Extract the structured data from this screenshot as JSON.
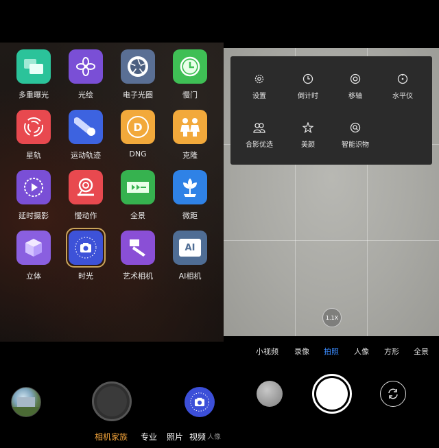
{
  "left": {
    "modes": [
      {
        "label": "多重曝光",
        "icon": "multi-exposure-icon",
        "color": "#2bc39a"
      },
      {
        "label": "光绘",
        "icon": "light-painting-icon",
        "color": "#7a4fd6"
      },
      {
        "label": "电子光圈",
        "icon": "aperture-icon",
        "color": "#5a6f94"
      },
      {
        "label": "慢门",
        "icon": "slow-shutter-icon",
        "color": "#3fbf55"
      },
      {
        "label": "星轨",
        "icon": "star-trail-icon",
        "color": "#e8494f"
      },
      {
        "label": "运动轨迹",
        "icon": "motion-trail-icon",
        "color": "#3d63e0"
      },
      {
        "label": "DNG",
        "icon": "dng-icon",
        "color": "#f2a93b"
      },
      {
        "label": "克隆",
        "icon": "clone-icon",
        "color": "#f2a93b"
      },
      {
        "label": "延时摄影",
        "icon": "timelapse-icon",
        "color": "#7a4fd6"
      },
      {
        "label": "慢动作",
        "icon": "slow-motion-icon",
        "color": "#e8494f"
      },
      {
        "label": "全景",
        "icon": "panorama-icon",
        "color": "#36b24f"
      },
      {
        "label": "微距",
        "icon": "macro-icon",
        "color": "#2f82e6"
      },
      {
        "label": "立体",
        "icon": "cube-icon",
        "color": "#8a5fe0"
      },
      {
        "label": "时光",
        "icon": "time-camera-icon",
        "color": "#3d52d8"
      },
      {
        "label": "艺术相机",
        "icon": "art-brush-icon",
        "color": "#8a4fd6"
      },
      {
        "label": "AI相机",
        "icon": "ai-camera-icon",
        "color": "#4f6d94"
      }
    ],
    "dng_letter": "D",
    "ai_text": "AI",
    "tabs": [
      {
        "label": "相机家族",
        "state": "active"
      },
      {
        "label": "专业",
        "state": "normal"
      },
      {
        "label": "照片",
        "state": "normal"
      },
      {
        "label": "视频",
        "state": "normal"
      },
      {
        "label": "人像",
        "state": "faded"
      }
    ],
    "accent_color": "#f0a23a",
    "selected_mode": "时光"
  },
  "right": {
    "settings": [
      {
        "label": "设置",
        "icon": "gear-icon"
      },
      {
        "label": "倒计时",
        "icon": "timer-icon"
      },
      {
        "label": "移轴",
        "icon": "tilt-shift-icon"
      },
      {
        "label": "水平仪",
        "icon": "level-icon"
      },
      {
        "label": "合影优选",
        "icon": "group-photo-icon"
      },
      {
        "label": "美颜",
        "icon": "beauty-icon"
      },
      {
        "label": "智能识物",
        "icon": "object-recognition-icon"
      }
    ],
    "zoom": "1.1X",
    "tabs": [
      {
        "label": "小视频",
        "state": "normal"
      },
      {
        "label": "录像",
        "state": "normal"
      },
      {
        "label": "拍照",
        "state": "active"
      },
      {
        "label": "人像",
        "state": "normal"
      },
      {
        "label": "方形",
        "state": "normal"
      },
      {
        "label": "全景",
        "state": "normal"
      }
    ],
    "accent_color": "#3b8cff"
  }
}
